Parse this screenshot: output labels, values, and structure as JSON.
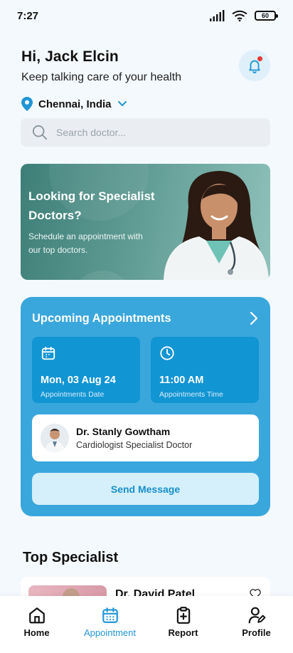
{
  "status_bar": {
    "time": "7:27",
    "battery": "60"
  },
  "greeting": {
    "title": "Hi, Jack Elcin",
    "subtitle": "Keep talking care of your health"
  },
  "location": {
    "city": "Chennai, India"
  },
  "search": {
    "placeholder": "Search doctor..."
  },
  "banner": {
    "title": "Looking for Specialist Doctors?",
    "subtitle": "Schedule an appointment with our top doctors."
  },
  "appointments": {
    "title": "Upcoming Appointments",
    "date_value": "Mon, 03 Aug 24",
    "date_label": "Appointments Date",
    "time_value": "11:00 AM",
    "time_label": "Appointments Time",
    "doctor_name": "Dr. Stanly Gowtham",
    "doctor_specialty": "Cardiologist Specialist Doctor",
    "send_label": "Send Message"
  },
  "top_specialist": {
    "title": "Top Specialist",
    "first_name": "Dr. David Patel"
  },
  "nav": {
    "items": [
      {
        "label": "Home",
        "icon": "home-icon"
      },
      {
        "label": "Appointment",
        "icon": "calendar-icon"
      },
      {
        "label": "Report",
        "icon": "report-icon"
      },
      {
        "label": "Profile",
        "icon": "profile-icon"
      }
    ],
    "active": "Appointment"
  },
  "colors": {
    "accent": "#2196d6",
    "card_blue": "#3aa7dc",
    "tile_blue": "#1295d3",
    "notification": "#e53935"
  }
}
